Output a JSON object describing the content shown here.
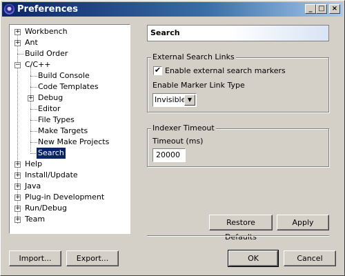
{
  "window": {
    "title": "Preferences",
    "min_label": "_",
    "max_label": "□",
    "close_label": "×"
  },
  "tree": {
    "items": [
      {
        "label": "Workbench",
        "expander": "+"
      },
      {
        "label": "Ant",
        "expander": "+"
      },
      {
        "label": "Build Order",
        "expander": ""
      },
      {
        "label": "C/C++",
        "expander": "−"
      },
      {
        "label": "Build Console",
        "expander": ""
      },
      {
        "label": "Code Templates",
        "expander": ""
      },
      {
        "label": "Debug",
        "expander": "+"
      },
      {
        "label": "Editor",
        "expander": ""
      },
      {
        "label": "File Types",
        "expander": ""
      },
      {
        "label": "Make Targets",
        "expander": ""
      },
      {
        "label": "New Make Projects",
        "expander": ""
      },
      {
        "label": "Search",
        "expander": "",
        "selected": true
      },
      {
        "label": "Help",
        "expander": "+"
      },
      {
        "label": "Install/Update",
        "expander": "+"
      },
      {
        "label": "Java",
        "expander": "+"
      },
      {
        "label": "Plug-in Development",
        "expander": "+"
      },
      {
        "label": "Run/Debug",
        "expander": "+"
      },
      {
        "label": "Team",
        "expander": "+"
      }
    ]
  },
  "page": {
    "title": "Search",
    "external_links": {
      "group_label": "External Search Links",
      "checkbox_label": "Enable external search markers",
      "checkbox_checked": true,
      "check_mark": "✔",
      "marker_type_label": "Enable Marker Link Type",
      "marker_type_value": "Invisible",
      "dropdown_arrow": "▼"
    },
    "indexer": {
      "group_label": "Indexer Timeout",
      "timeout_label": "Timeout (ms)",
      "timeout_value": "20000"
    },
    "restore_defaults_label": "Restore Defaults",
    "apply_label": "Apply"
  },
  "footer": {
    "import_label": "Import...",
    "export_label": "Export...",
    "ok_label": "OK",
    "cancel_label": "Cancel"
  },
  "colors": {
    "selection": "#0a246a",
    "titlebar": "#0a246a",
    "face": "#d4d0c8"
  }
}
